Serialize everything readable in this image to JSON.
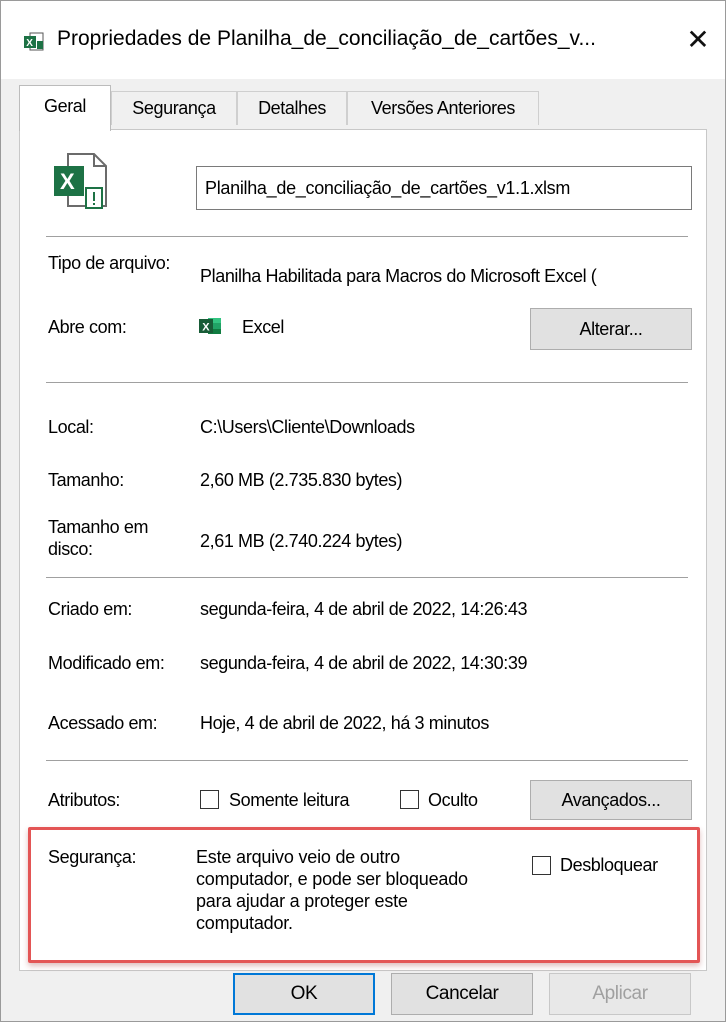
{
  "window": {
    "title": "Propriedades de Planilha_de_conciliação_de_cartões_v...",
    "close_glyph": "✕"
  },
  "tabs": [
    {
      "label": "Geral",
      "active": true
    },
    {
      "label": "Segurança",
      "active": false
    },
    {
      "label": "Detalhes",
      "active": false
    },
    {
      "label": "Versões Anteriores",
      "active": false
    }
  ],
  "general": {
    "file_icon": "excel-macro-file-icon",
    "filename": "Planilha_de_conciliação_de_cartões_v1.1.xlsm",
    "type_label": "Tipo de arquivo:",
    "type_value": "Planilha Habilitada para Macros do Microsoft Excel (",
    "opens_with_label": "Abre com:",
    "opens_with_icon": "excel-app-icon",
    "opens_with_value": "Excel",
    "change_button": "Alterar...",
    "location_label": "Local:",
    "location_value": "C:\\Users\\Cliente\\Downloads",
    "size_label": "Tamanho:",
    "size_value": "2,60 MB (2.735.830 bytes)",
    "size_on_disk_label": "Tamanho em disco:",
    "size_on_disk_value": "2,61 MB (2.740.224 bytes)",
    "created_label": "Criado em:",
    "created_value": "segunda-feira, 4 de abril de 2022, 14:26:43",
    "modified_label": "Modificado em:",
    "modified_value": "segunda-feira, 4 de abril de 2022, 14:30:39",
    "accessed_label": "Acessado em:",
    "accessed_value": "Hoje, 4 de abril de 2022, há 3 minutos",
    "attributes_label": "Atributos:",
    "readonly_label": "Somente leitura",
    "readonly_checked": false,
    "hidden_label": "Oculto",
    "hidden_checked": false,
    "advanced_button": "Avançados...",
    "security_label": "Segurança:",
    "security_text": "Este arquivo veio de outro computador, e pode ser bloqueado para ajudar a proteger este computador.",
    "unblock_label": "Desbloquear",
    "unblock_checked": false
  },
  "buttons": {
    "ok": "OK",
    "cancel": "Cancelar",
    "apply": "Aplicar"
  },
  "colors": {
    "excel_green": "#1d7245",
    "highlight_red": "#e35555",
    "focus_blue": "#0078d7"
  }
}
